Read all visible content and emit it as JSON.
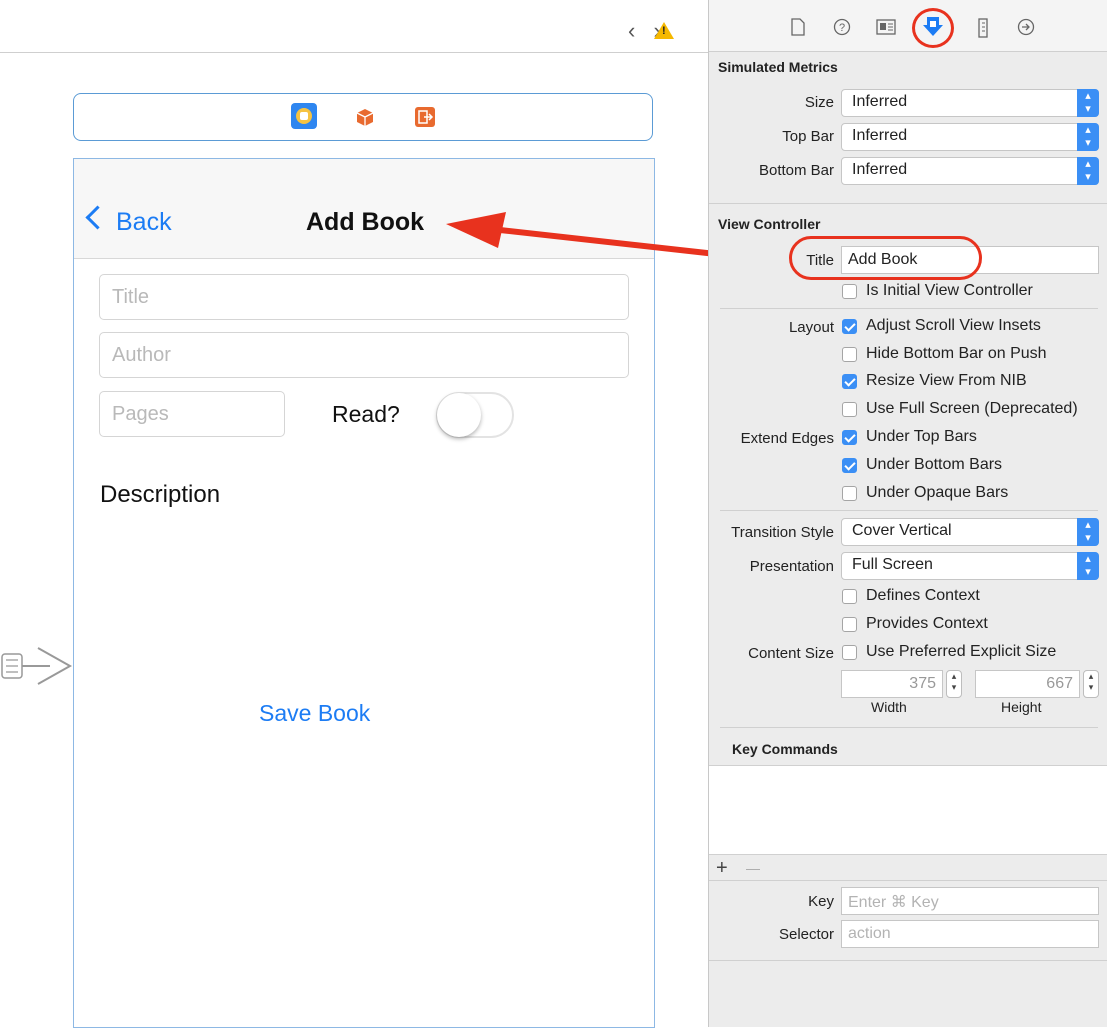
{
  "toolbar": {
    "nav_arrows": "‹ ›",
    "warning_glyph": "!"
  },
  "scene": {
    "nav": {
      "back_label": "Back",
      "title": "Add Book"
    },
    "fields": {
      "title_placeholder": "Title",
      "author_placeholder": "Author",
      "pages_placeholder": "Pages"
    },
    "read_label": "Read?",
    "read_switch_on": false,
    "description_label": "Description",
    "save_button": "Save Book"
  },
  "inspector": {
    "simulated_metrics": {
      "header": "Simulated Metrics",
      "size_label": "Size",
      "size_value": "Inferred",
      "top_bar_label": "Top Bar",
      "top_bar_value": "Inferred",
      "bottom_bar_label": "Bottom Bar",
      "bottom_bar_value": "Inferred"
    },
    "view_controller": {
      "header": "View Controller",
      "title_label": "Title",
      "title_value": "Add Book",
      "is_initial": "Is Initial View Controller",
      "layout_label": "Layout",
      "adjust_scroll": "Adjust Scroll View Insets",
      "hide_bottom": "Hide Bottom Bar on Push",
      "resize_nib": "Resize View From NIB",
      "full_screen": "Use Full Screen (Deprecated)",
      "extend_edges_label": "Extend Edges",
      "under_top": "Under Top Bars",
      "under_bottom": "Under Bottom Bars",
      "under_opaque": "Under Opaque Bars",
      "transition_label": "Transition Style",
      "transition_value": "Cover Vertical",
      "presentation_label": "Presentation",
      "presentation_value": "Full Screen",
      "defines_context": "Defines Context",
      "provides_context": "Provides Context",
      "content_size_label": "Content Size",
      "preferred_size": "Use Preferred Explicit Size",
      "width_value": "375",
      "height_value": "667",
      "width_label": "Width",
      "height_label": "Height"
    },
    "key_commands": {
      "header": "Key Commands",
      "add": "+",
      "remove": "—",
      "key_label": "Key",
      "key_placeholder": "Enter ⌘ Key",
      "selector_label": "Selector",
      "selector_placeholder": "action"
    }
  },
  "colors": {
    "accent": "#1c7cf4",
    "annotation": "#e8321e",
    "checkbox": "#3b8ff5"
  }
}
